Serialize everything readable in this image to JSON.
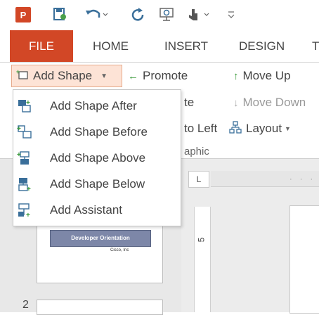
{
  "qat": {
    "logo_text": "P",
    "icons": [
      "powerpoint-logo-icon",
      "save-icon",
      "undo-icon",
      "redo-icon",
      "start-slideshow-icon",
      "touch-mode-icon",
      "customize-qat-icon"
    ]
  },
  "tabs": [
    {
      "label": "FILE"
    },
    {
      "label": "HOME"
    },
    {
      "label": "INSERT"
    },
    {
      "label": "DESIGN"
    },
    {
      "label": "T"
    }
  ],
  "ribbon": {
    "add_shape_label": "Add Shape",
    "promote_label": "Promote",
    "move_up_label": "Move Up",
    "demote_label": "te",
    "move_down_label": "Move Down",
    "right_to_left_label": "to Left",
    "layout_label": "Layout",
    "group_label": "aphic"
  },
  "add_shape_menu": {
    "items": [
      {
        "label": "Add Shape After"
      },
      {
        "label": "Add Shape Before"
      },
      {
        "label": "Add Shape Above"
      },
      {
        "label": "Add Shape Below"
      },
      {
        "label": "Add Assistant"
      }
    ]
  },
  "workspace": {
    "ruler_corner": "L",
    "vertical_ruler_number": "5",
    "slide1_title": "Developer Orientation",
    "slide1_sub": "Cisco, Inc",
    "slide2_number": "2"
  },
  "colors": {
    "accent": "#d24726",
    "add_shape_highlight": "#fde3d6",
    "icon_blue": "#3a6f9a",
    "icon_green": "#3a9a3a"
  }
}
